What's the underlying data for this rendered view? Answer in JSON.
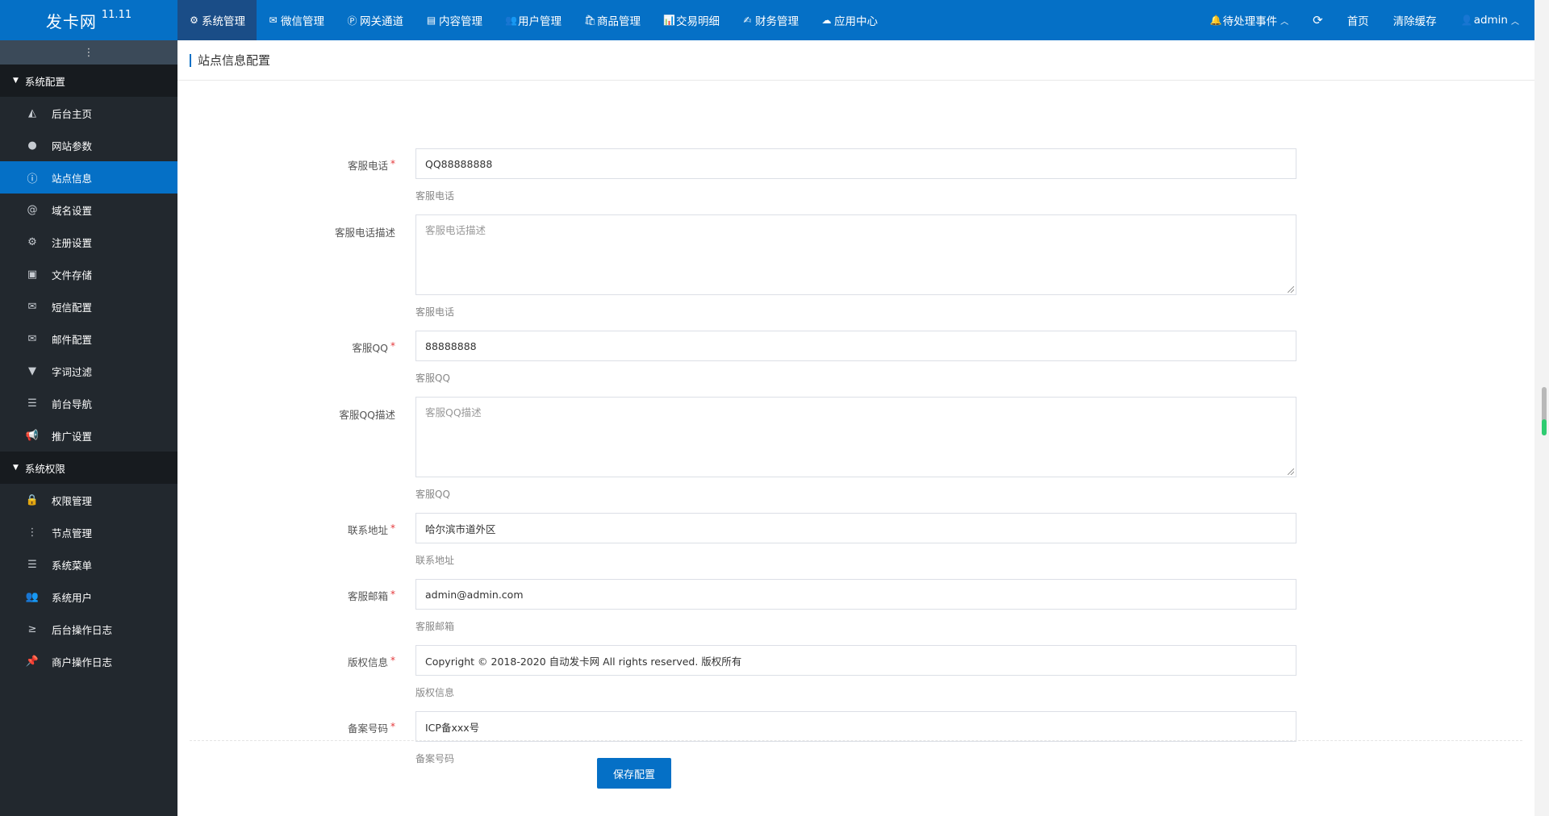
{
  "brand": {
    "name": "发卡网",
    "version": "11.11"
  },
  "topnav": [
    {
      "icon": "⚙",
      "label": "系统管理",
      "active": true
    },
    {
      "icon": "✉",
      "label": "微信管理"
    },
    {
      "icon": "Ⓟ",
      "label": "网关通道"
    },
    {
      "icon": "▤",
      "label": "内容管理"
    },
    {
      "icon": "👥",
      "label": "用户管理"
    },
    {
      "icon": "🛍",
      "label": "商品管理"
    },
    {
      "icon": "📊",
      "label": "交易明细"
    },
    {
      "icon": "✍",
      "label": "财务管理"
    },
    {
      "icon": "☁",
      "label": "应用中心"
    }
  ],
  "topright": {
    "pending": "待处理事件",
    "home": "首页",
    "clear_cache": "清除缓存",
    "user": "admin"
  },
  "sidebar": {
    "groups": [
      {
        "title": "系统配置",
        "items": [
          {
            "label": "后台主页",
            "icon": "area-chart-icon"
          },
          {
            "label": "网站参数",
            "icon": "apple-icon"
          },
          {
            "label": "站点信息",
            "icon": "info-icon",
            "active": true
          },
          {
            "label": "域名设置",
            "icon": "at-icon"
          },
          {
            "label": "注册设置",
            "icon": "gear-icon"
          },
          {
            "label": "文件存储",
            "icon": "save-icon"
          },
          {
            "label": "短信配置",
            "icon": "envelope-icon"
          },
          {
            "label": "邮件配置",
            "icon": "envelope-icon"
          },
          {
            "label": "字词过滤",
            "icon": "filter-icon"
          },
          {
            "label": "前台导航",
            "icon": "bars-icon"
          },
          {
            "label": "推广设置",
            "icon": "bullhorn-icon"
          }
        ]
      },
      {
        "title": "系统权限",
        "items": [
          {
            "label": "权限管理",
            "icon": "lock-icon"
          },
          {
            "label": "节点管理",
            "icon": "ellipsis-icon"
          },
          {
            "label": "系统菜单",
            "icon": "bars-icon"
          },
          {
            "label": "系统用户",
            "icon": "users-icon"
          },
          {
            "label": "后台操作日志",
            "icon": "terminal-icon"
          },
          {
            "label": "商户操作日志",
            "icon": "pin-icon"
          }
        ]
      }
    ]
  },
  "page": {
    "title": "站点信息配置"
  },
  "form": {
    "fields": [
      {
        "label": "客服电话",
        "required": true,
        "type": "input",
        "value": "QQ88888888",
        "help": "客服电话"
      },
      {
        "label": "客服电话描述",
        "required": false,
        "type": "textarea",
        "placeholder": "客服电话描述",
        "help": "客服电话"
      },
      {
        "label": "客服QQ",
        "required": true,
        "type": "input",
        "value": "88888888",
        "help": "客服QQ"
      },
      {
        "label": "客服QQ描述",
        "required": false,
        "type": "textarea",
        "placeholder": "客服QQ描述",
        "help": "客服QQ"
      },
      {
        "label": "联系地址",
        "required": true,
        "type": "input",
        "value": "哈尔滨市道外区",
        "help": "联系地址"
      },
      {
        "label": "客服邮箱",
        "required": true,
        "type": "input",
        "value": "admin@admin.com",
        "help": "客服邮箱"
      },
      {
        "label": "版权信息",
        "required": true,
        "type": "input",
        "value": "Copyright © 2018-2020 自动发卡网 All rights reserved. 版权所有",
        "help": "版权信息"
      },
      {
        "label": "备案号码",
        "required": true,
        "type": "input",
        "value": "ICP备xxx号",
        "help": "备案号码"
      }
    ],
    "save_label": "保存配置"
  },
  "colors": {
    "primary": "#0570c6",
    "sidebar_bg": "#22282e",
    "sidebar_group_bg": "#171b1f",
    "required": "#e4393c"
  }
}
